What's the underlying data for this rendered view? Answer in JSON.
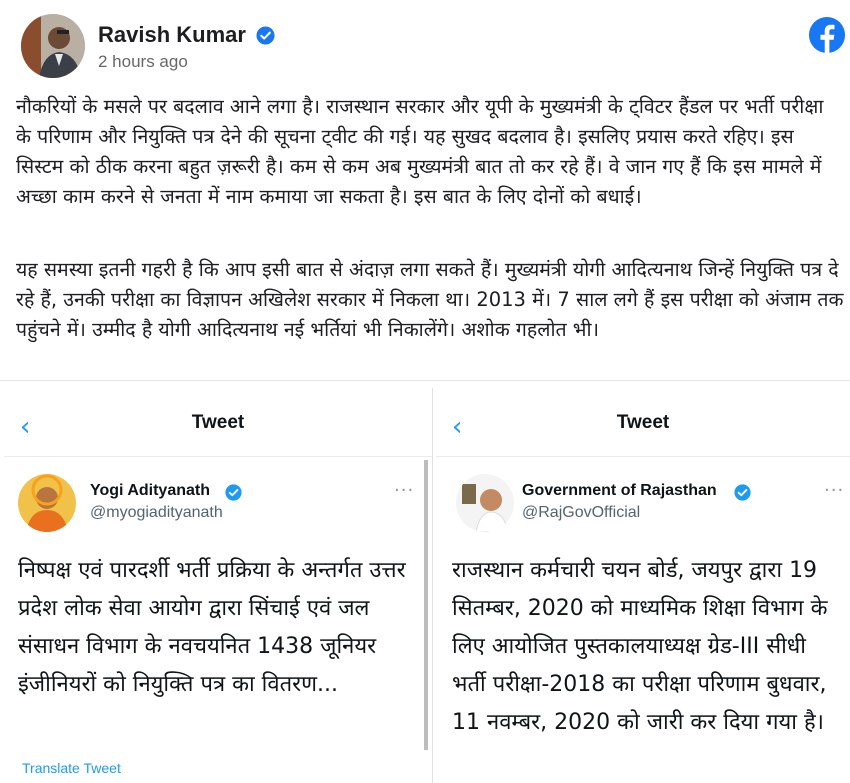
{
  "post": {
    "author": "Ravish Kumar",
    "time": "2 hours ago",
    "paragraph1": "नौकरियों के मसले पर बदलाव आने लगा है। राजस्थान सरकार और यूपी के मुख्यमंत्री के ट्विटर हैंडल पर भर्ती परीक्षा के परिणाम और नियुक्ति पत्र देने की सूचना ट्वीट की गई। यह सुखद बदलाव है। इसलिए प्रयास करते रहिए। इस सिस्टम को ठीक करना बहुत ज़रूरी है। कम से कम अब मुख्यमंत्री बात तो कर रहे हैं। वे जान गए हैं कि इस मामले में अच्छा काम करने से जनता में नाम कमाया जा सकता है। इस बात के लिए दोनों को बधाई।",
    "paragraph2": "यह समस्या इतनी गहरी है कि आप इसी बात से अंदाज़ लगा सकते हैं। मुख्यमंत्री योगी आदित्यनाथ जिन्हें नियुक्ति पत्र दे रहे हैं, उनकी परीक्षा का विज्ञापन अखिलेश सरकार में निकला था। 2013 में। 7 साल लगे हैं इस परीक्षा को अंजाम तक पहुंचने में। उम्मीद है योगी आदित्यनाथ नई भर्तियां भी निकालेंगे। अशोक गहलोत भी।"
  },
  "tweets": [
    {
      "nav_title": "Tweet",
      "name": "Yogi Adityanath",
      "handle": "@myogiadityanath",
      "more": "···",
      "text": "निष्पक्ष एवं पारदर्शी भर्ती प्रक्रिया के अन्तर्गत उत्तर प्रदेश लोक सेवा आयोग द्वारा सिंचाई एवं जल संसाधन विभाग के नवचयनित 1438 जूनियर इंजीनियरों को नियुक्ति पत्र का वितरण...",
      "translate": "Translate Tweet"
    },
    {
      "nav_title": "Tweet",
      "name": "Government of Rajasthan",
      "handle": "@RajGovOfficial",
      "more": "···",
      "text": "राजस्थान कर्मचारी चयन बोर्ड, जयपुर द्वारा 19 सितम्बर, 2020 को माध्यमिक शिक्षा विभाग के लिए आयोजित पुस्तकालयाध्यक्ष ग्रेड-III सीधी भर्ती परीक्षा-2018 का परीक्षा परिणाम बुधवार, 11 नवम्बर, 2020 को जारी कर दिया गया है।"
    }
  ],
  "colors": {
    "facebook_blue": "#1877f2",
    "twitter_blue": "#1d9bf0",
    "text": "#1c1e21",
    "muted": "#65676b"
  },
  "icons": [
    "verified-badge-icon",
    "facebook-logo-icon",
    "back-arrow-icon",
    "more-options-icon"
  ]
}
